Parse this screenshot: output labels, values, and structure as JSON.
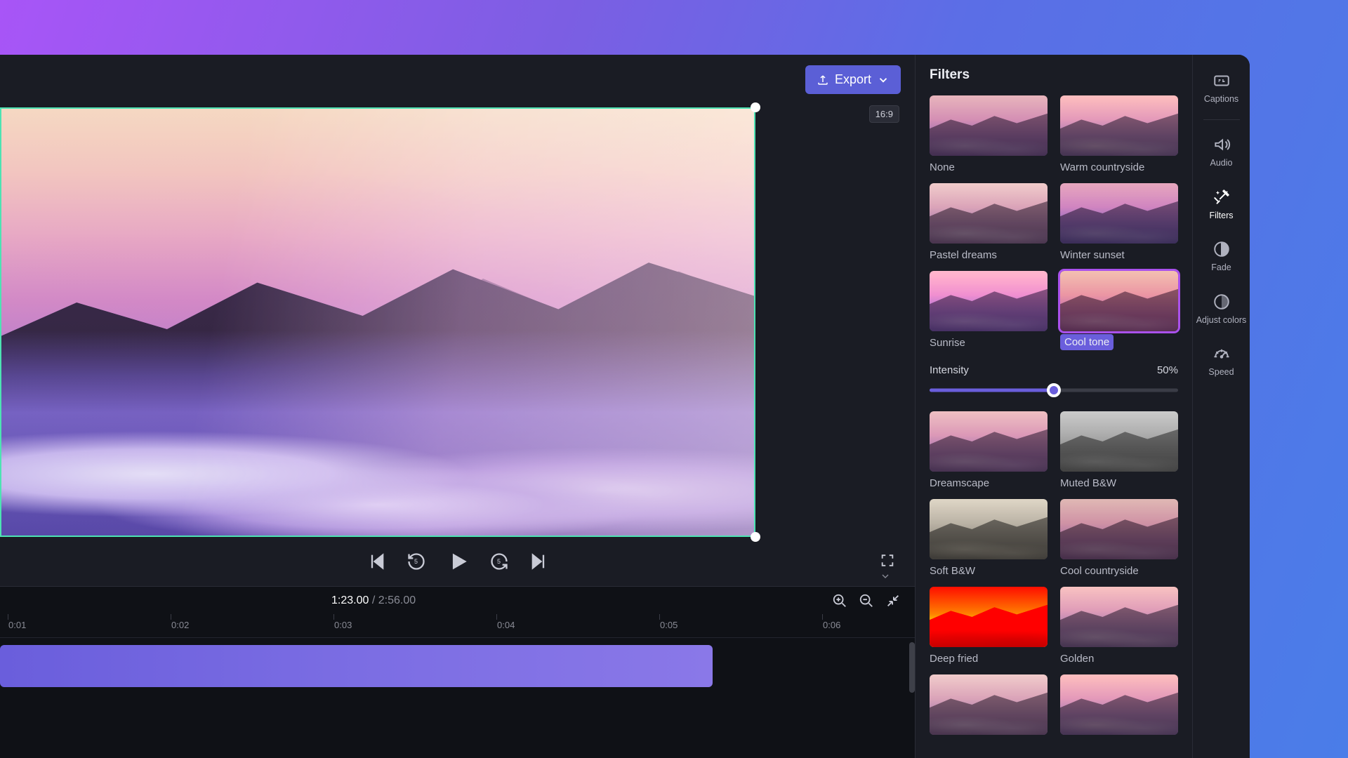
{
  "header": {
    "export_label": "Export",
    "aspect_ratio": "16:9"
  },
  "playback": {
    "current_time": "1:23.00",
    "duration": "2:56.00",
    "skip_back_amount": "5",
    "skip_forward_amount": "5"
  },
  "timeline": {
    "ticks": [
      "0:01",
      "0:02",
      "0:03",
      "0:04",
      "0:05",
      "0:06"
    ]
  },
  "filters_panel": {
    "title": "Filters",
    "intensity_label": "Intensity",
    "intensity_value": "50%",
    "intensity_percent": 50,
    "selected": "Cool tone",
    "items_before": [
      {
        "name": "None",
        "variant": ""
      },
      {
        "name": "Warm countryside",
        "variant": "warm"
      },
      {
        "name": "Pastel dreams",
        "variant": "pastel"
      },
      {
        "name": "Winter sunset",
        "variant": "winter"
      },
      {
        "name": "Sunrise",
        "variant": "sunrise"
      },
      {
        "name": "Cool tone",
        "variant": "cool"
      }
    ],
    "items_after": [
      {
        "name": "Dreamscape",
        "variant": "dream"
      },
      {
        "name": "Muted B&W",
        "variant": "mbw"
      },
      {
        "name": "Soft B&W",
        "variant": "sbw"
      },
      {
        "name": "Cool countryside",
        "variant": "ccountry"
      },
      {
        "name": "Deep fried",
        "variant": "fried"
      },
      {
        "name": "Golden",
        "variant": "golden"
      },
      {
        "name": "",
        "variant": "pastel"
      },
      {
        "name": "",
        "variant": "warm"
      }
    ]
  },
  "right_toolbar": {
    "items": [
      {
        "id": "captions",
        "label": "Captions"
      },
      {
        "id": "audio",
        "label": "Audio"
      },
      {
        "id": "filters",
        "label": "Filters"
      },
      {
        "id": "fade",
        "label": "Fade"
      },
      {
        "id": "adjust-colors",
        "label": "Adjust colors"
      },
      {
        "id": "speed",
        "label": "Speed"
      }
    ],
    "active": "filters"
  },
  "colors": {
    "accent": "#6a5edc",
    "selection": "#4de3b3"
  }
}
